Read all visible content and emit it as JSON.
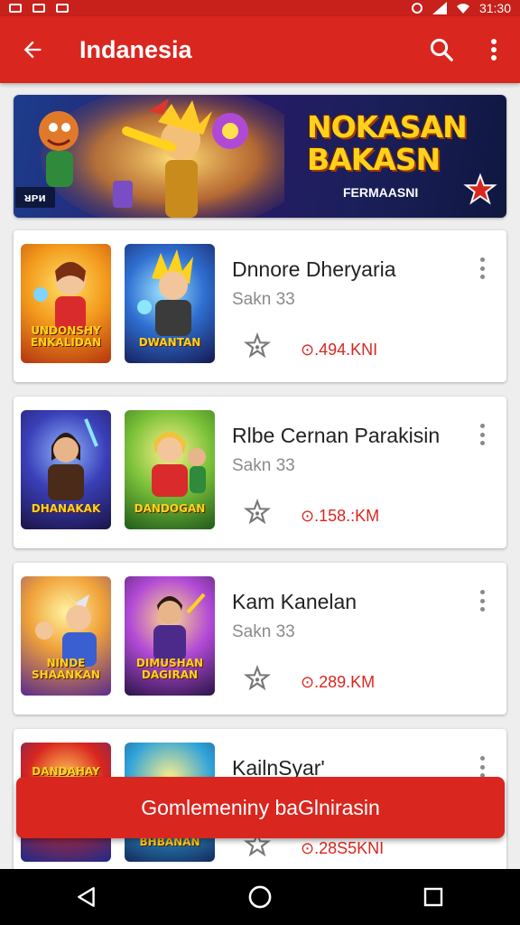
{
  "status_bar": {
    "time": "31:30"
  },
  "app_bar": {
    "title": "Indanesia",
    "icons": [
      "back-arrow-icon",
      "search-icon",
      "more-vert-icon"
    ]
  },
  "banner": {
    "heading": "NOKASAN BAKASN",
    "subtitle": "FERMAASNI",
    "badge": "ᴚᴘᴎ",
    "icons": [
      "star-icon"
    ]
  },
  "cards": [
    {
      "thumb_a_label": "UNDONSHY ENKALIDAN",
      "thumb_b_label": "DWANTAN",
      "title": "Dnnore Dheryaria",
      "subtitle": "Sakn 33",
      "distance": "⊙.494.KNI"
    },
    {
      "thumb_a_label": "DHANAKAK",
      "thumb_b_label": "DANDOGAN",
      "title": "Rlbe Cernan Parakisin",
      "subtitle": "Sakn 33",
      "distance": "⊙.158.:KM"
    },
    {
      "thumb_a_label": "NINDE SHAANKAN",
      "thumb_b_label": "DIMUSHAN DAGIRAN",
      "title": "Kam Kanelan",
      "subtitle": "Sakn 33",
      "distance": "⊙.289.KM"
    },
    {
      "thumb_a_label": "DANDAHAY",
      "thumb_b_label": "BHBANAN",
      "title": "KailnSyar'",
      "subtitle": "",
      "distance": "⊙.28S5KNI"
    }
  ],
  "cta": {
    "label": "Gomlemeniny baGlnirasin"
  },
  "nav_bar": {
    "icons": [
      "back-triangle-icon",
      "home-circle-icon",
      "recents-square-icon"
    ]
  },
  "colors": {
    "primary": "#d9261f",
    "status": "#c8201b",
    "background": "#eeeeee"
  }
}
